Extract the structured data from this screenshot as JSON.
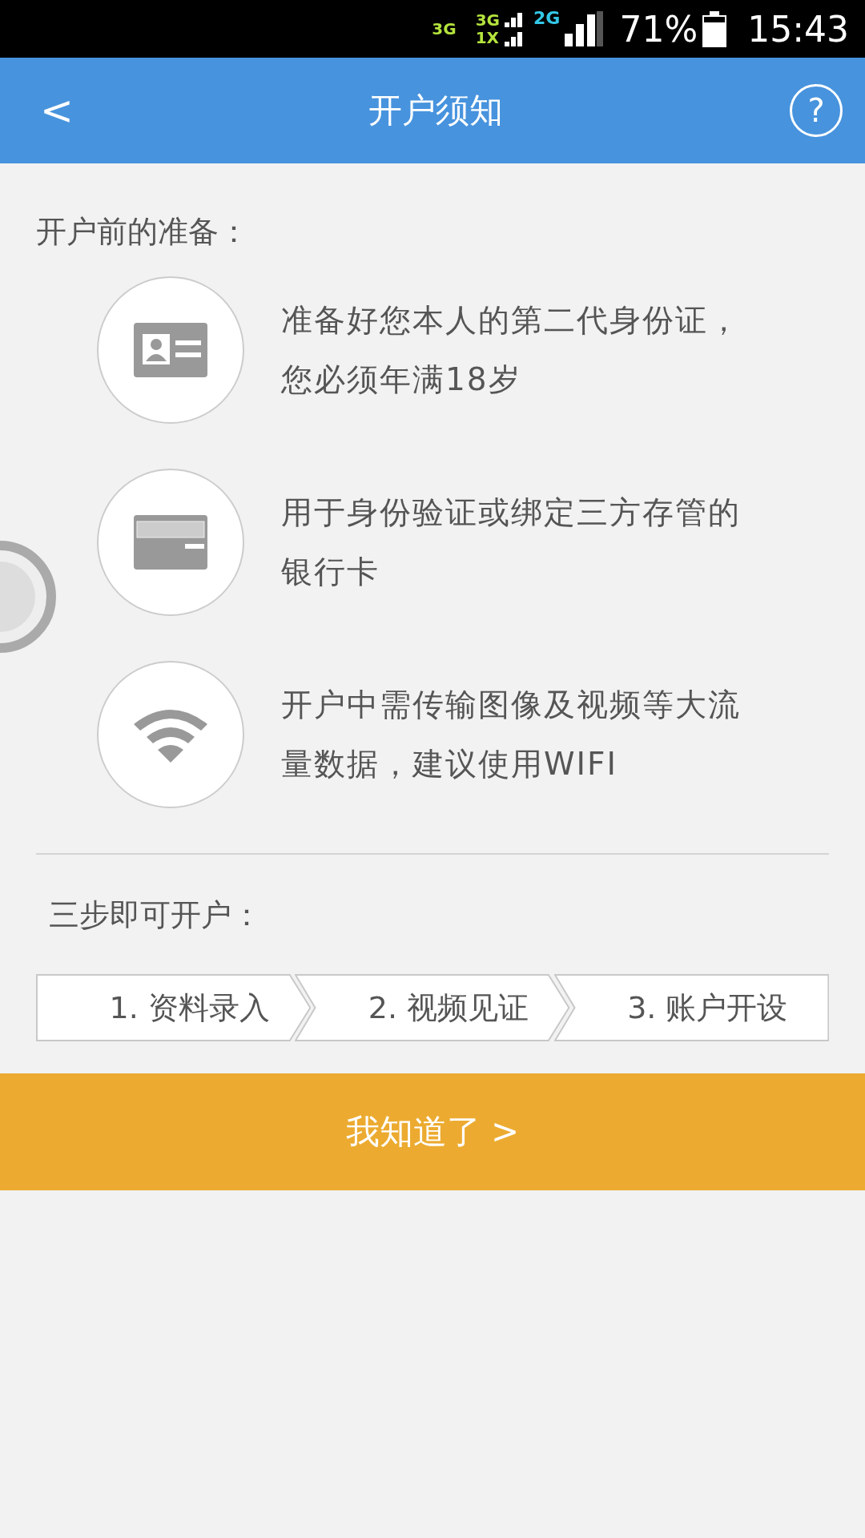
{
  "status_bar": {
    "network_1": "3G",
    "network_2_top": "3G",
    "network_2_bottom": "1X",
    "network_3": "2G",
    "battery": "71%",
    "time": "15:43"
  },
  "header": {
    "back": "<",
    "title": "开户须知",
    "help": "?"
  },
  "preparation": {
    "title": "开户前的准备：",
    "items": [
      {
        "kind": "id-card",
        "text": "准备好您本人的第二代身份证，您必须年满18岁"
      },
      {
        "kind": "bank-card",
        "text": "用于身份验证或绑定三方存管的银行卡"
      },
      {
        "kind": "wifi",
        "text": "开户中需传输图像及视频等大流量数据，建议使用WIFI"
      }
    ]
  },
  "steps": {
    "title": "三步即可开户：",
    "items": [
      "1. 资料录入",
      "2. 视频见证",
      "3. 账户开设"
    ]
  },
  "confirm_button": "我知道了 >"
}
